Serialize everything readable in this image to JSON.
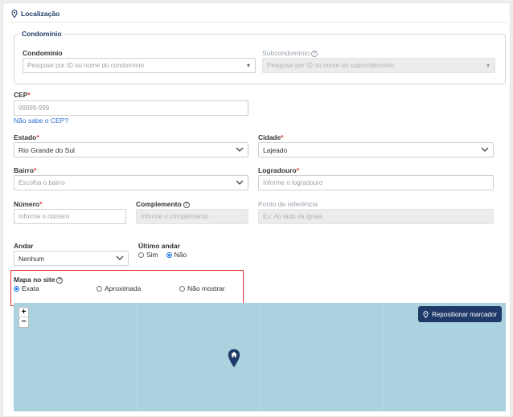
{
  "section": {
    "title": "Localização"
  },
  "condominio_group": {
    "legend": "Condomínio",
    "condominio_label": "Condomínio",
    "condominio_placeholder": "Pesquise por ID ou nome do condomínio",
    "subcondominio_label": "Subcondomínio",
    "subcondominio_placeholder": "Pesquise por ID ou nome do subcondomínio"
  },
  "cep": {
    "label": "CEP",
    "placeholder": "99999-999",
    "help_link": "Não sabe o CEP?"
  },
  "estado": {
    "label": "Estado",
    "value": "Rio Grande do Sul"
  },
  "cidade": {
    "label": "Cidade",
    "value": "Lajeado"
  },
  "bairro": {
    "label": "Bairro",
    "placeholder": "Escolha o bairro"
  },
  "logradouro": {
    "label": "Logradouro",
    "placeholder": "Informe o logradouro"
  },
  "numero": {
    "label": "Número",
    "placeholder": "Informe o número"
  },
  "complemento": {
    "label": "Complemento",
    "placeholder": "Informe o complemento"
  },
  "referencia": {
    "label": "Ponto de referência",
    "placeholder": "Ex: Ao lado da igreja"
  },
  "andar": {
    "label": "Andar",
    "value": "Nenhum"
  },
  "ultimo_andar": {
    "label": "Último andar",
    "options": [
      "Sim",
      "Não"
    ],
    "selected": "Não"
  },
  "mapa_site": {
    "label": "Mapa no site",
    "options": [
      "Exata",
      "Aproximada",
      "Não mostrar"
    ],
    "selected": "Exata"
  },
  "map": {
    "zoom_in": "+",
    "zoom_out": "−",
    "reposition_button": "Repositionar marcador",
    "water_color": "#aad3df",
    "marker_color": "#1f3a68"
  },
  "colors": {
    "accent": "#1f3a68",
    "required": "#e53935",
    "link": "#2f6fd6",
    "highlight": "#e03030"
  }
}
